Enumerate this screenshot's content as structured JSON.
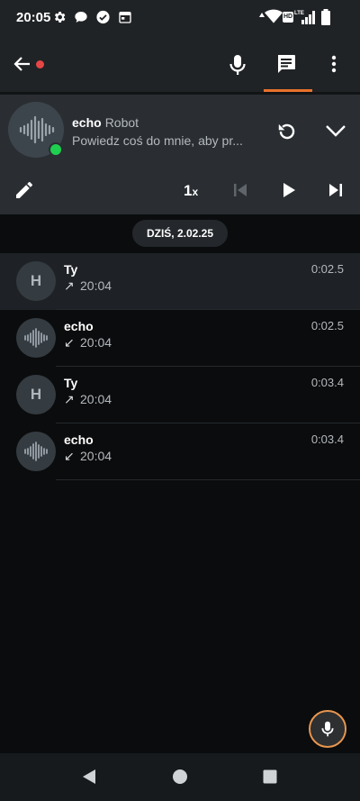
{
  "status_bar": {
    "time": "20:05",
    "icons": [
      "gear-icon",
      "chat-bubble-icon",
      "check-badge-icon",
      "calendar-icon",
      "wifi-icon",
      "hd-lte-signal-icon",
      "battery-icon"
    ],
    "hd_label": "HD",
    "lte_label": "LTE"
  },
  "app_bar": {
    "icons": [
      "back-arrow-icon",
      "microphone-icon",
      "message-icon",
      "more-vert-icon"
    ],
    "recording_color": "#e64646",
    "accent_color": "#e8722c"
  },
  "contact": {
    "name": "echo",
    "role": "Robot",
    "status": "Powiedz coś do mnie, aby pr...",
    "online_color": "#1fcf4f",
    "speed": "1",
    "speed_suffix": "x"
  },
  "conversation": {
    "date": "DZIŚ, 2.02.25",
    "messages": [
      {
        "sender": "Ty",
        "initial": "H",
        "direction": "outgoing",
        "arrow": "↗",
        "time": "20:04",
        "duration": "0:02.5",
        "selected": true
      },
      {
        "sender": "echo",
        "initial": "",
        "direction": "incoming",
        "arrow": "↙",
        "time": "20:04",
        "duration": "0:02.5",
        "selected": false
      },
      {
        "sender": "Ty",
        "initial": "H",
        "direction": "outgoing",
        "arrow": "↗",
        "time": "20:04",
        "duration": "0:03.4",
        "selected": false
      },
      {
        "sender": "echo",
        "initial": "",
        "direction": "incoming",
        "arrow": "↙",
        "time": "20:04",
        "duration": "0:03.4",
        "selected": false
      }
    ]
  },
  "fab": {
    "icon": "microphone-icon",
    "border_color": "#e8964e"
  },
  "nav_bar": {
    "icons": [
      "back-triangle-icon",
      "home-circle-icon",
      "recents-square-icon"
    ]
  }
}
